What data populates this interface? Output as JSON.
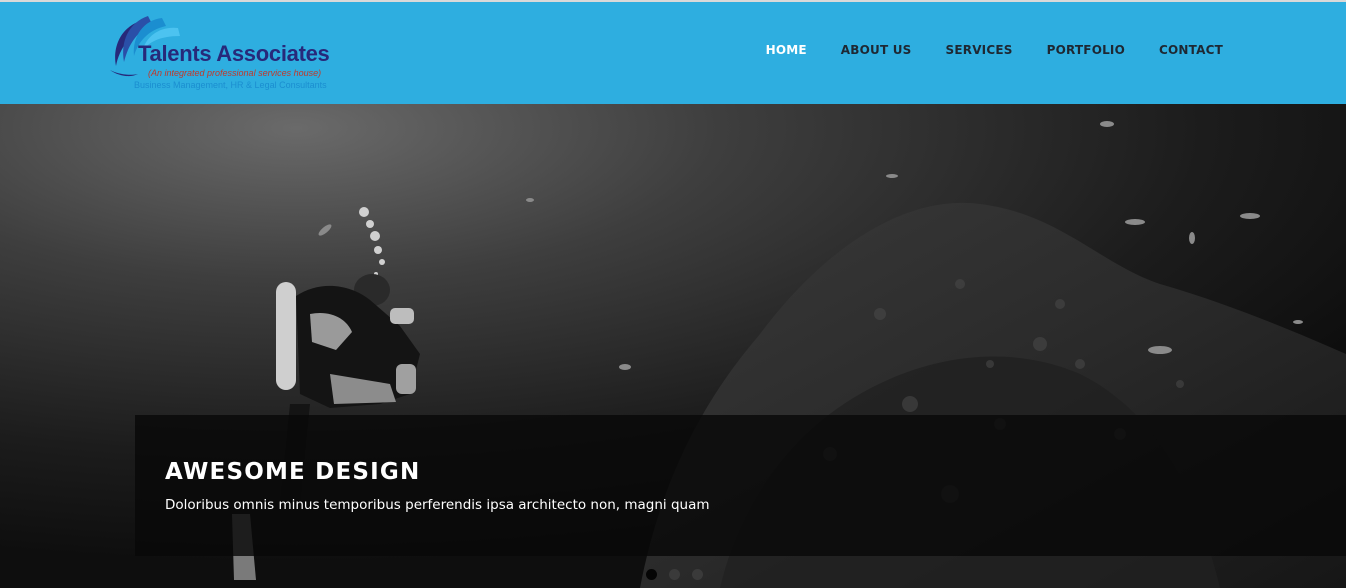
{
  "logo": {
    "title": "Talents Associates",
    "tagline": "(An integrated professional services house)",
    "subline": "Business Management, HR & Legal Consultants",
    "colors": {
      "navy": "#27297a",
      "blue": "#1b8ed0",
      "red": "#c0392b"
    }
  },
  "nav": {
    "items": [
      {
        "label": "HOME",
        "active": true
      },
      {
        "label": "ABOUT US",
        "active": false
      },
      {
        "label": "SERVICES",
        "active": false
      },
      {
        "label": "PORTFOLIO",
        "active": false
      },
      {
        "label": "CONTACT",
        "active": false
      }
    ]
  },
  "hero": {
    "title": "AWESOME DESIGN",
    "text": "Doloribus omnis minus temporibus perferendis ipsa architecto non, magni quam",
    "image": "underwater-diver-grayscale",
    "slides": {
      "count": 3,
      "active": 1
    }
  },
  "colors": {
    "header": "#2eaee0",
    "nav_active": "#ffffff",
    "nav_text": "#1e2833"
  }
}
